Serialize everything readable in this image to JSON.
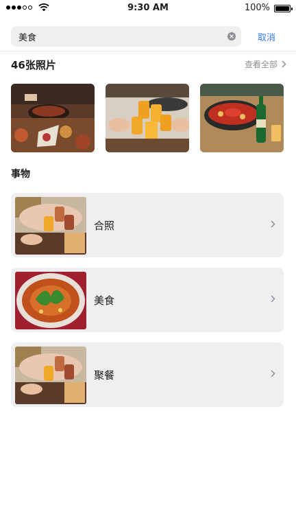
{
  "status_bar": {
    "time": "9:30 AM",
    "battery": "100%"
  },
  "search": {
    "query": "美食",
    "cancel_label": "取消"
  },
  "photos_section": {
    "title": "46张照片",
    "see_all_label": "查看全部"
  },
  "things_section": {
    "title": "事物",
    "items": [
      {
        "label": "合照"
      },
      {
        "label": "美食"
      },
      {
        "label": "聚餐"
      }
    ]
  },
  "colors": {
    "accent": "#3478f6",
    "card_bg": "#efeff1",
    "secondary_text": "#8e8e93"
  },
  "icons": [
    "signal-icon",
    "wifi-icon",
    "battery-icon",
    "clear-icon",
    "chevron-right-icon"
  ]
}
